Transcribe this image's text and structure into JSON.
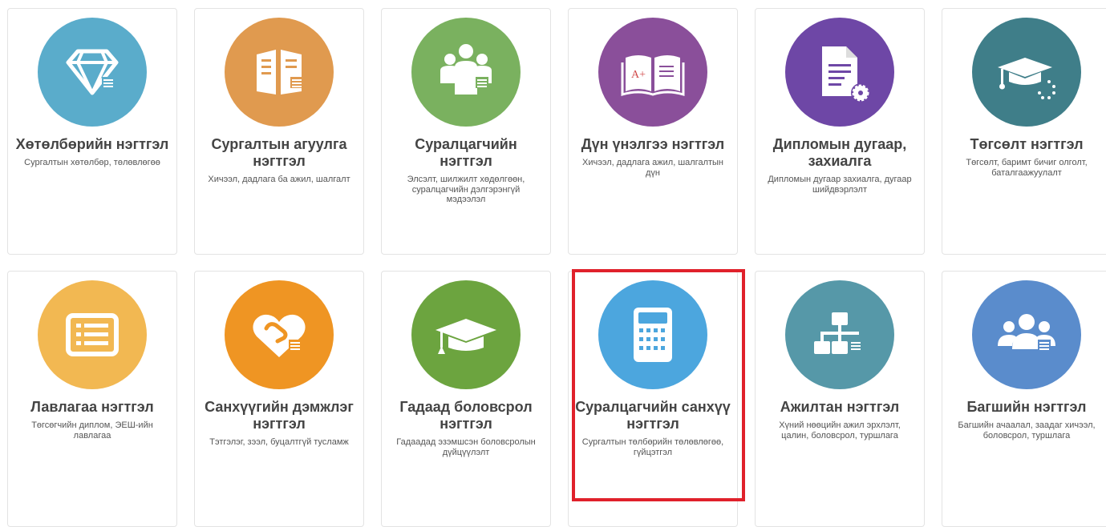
{
  "modules": [
    {
      "title": "Хөтөлбөрийн нэгтгэл",
      "description": "Сургалтын хөтөлбөр, төлөвлөгөө",
      "color": "#5aaccb",
      "icon": "diamond-icon"
    },
    {
      "title": "Сургалтын агуулга нэгтгэл",
      "description": "Хичээл, дадлага ба ажил, шалгалт",
      "color": "#e09a4f",
      "icon": "open-book-icon"
    },
    {
      "title": "Суралцагчийн нэгтгэл",
      "description": "Элсэлт, шилжилт хөдөлгөөн, суралцагчийн дэлгэрэнгүй мэдээлэл",
      "color": "#7ab15f",
      "icon": "students-icon"
    },
    {
      "title": "Дүн үнэлгээ нэгтгэл",
      "description": "Хичээл, дадлага ажил, шалгалтын дүн",
      "color": "#8a4f9a",
      "icon": "graded-book-icon"
    },
    {
      "title": "Дипломын дугаар, захиалга",
      "description": "Дипломын дугаар захиалга, дугаар шийдвэрлэлт",
      "color": "#6e47a6",
      "icon": "document-gear-icon"
    },
    {
      "title": "Төгсөлт нэгтгэл",
      "description": "Төгсөлт, баримт бичиг олголт, баталгаажуулалт",
      "color": "#3f7e89",
      "icon": "graduation-loading-icon"
    },
    {
      "title": "Лавлагаа нэгтгэл",
      "description": "Төгсөгчийн диплом, ЭЕШ-ийн лавлагаа",
      "color": "#f2b852",
      "icon": "list-icon"
    },
    {
      "title": "Санхүүгийн дэмжлэг нэгтгэл",
      "description": "Тэтгэлэг, зээл, буцалтгүй тусламж",
      "color": "#ef9523",
      "icon": "heart-hand-icon"
    },
    {
      "title": "Гадаад боловсрол нэгтгэл",
      "description": "Гадаадад эзэмшсэн боловсролын дүйцүүлэлт",
      "color": "#6ca43f",
      "icon": "graduation-cap-icon"
    },
    {
      "title": "Суралцагчийн санхүү нэгтгэл",
      "description": "Сургалтын төлбөрийн төлөвлөгөө, гүйцэтгэл",
      "color": "#4ca6de",
      "icon": "calculator-icon"
    },
    {
      "title": "Ажилтан нэгтгэл",
      "description": "Хүний нөөцийн ажил эрхлэлт, цалин, боловсрол, туршлага",
      "color": "#5698a8",
      "icon": "org-chart-icon"
    },
    {
      "title": "Багшийн нэгтгэл",
      "description": "Багшийн ачаалал, заадаг хичээл, боловсрол, туршлага",
      "color": "#5a8ccc",
      "icon": "users-icon"
    }
  ],
  "highlight_color": "#e0212b"
}
